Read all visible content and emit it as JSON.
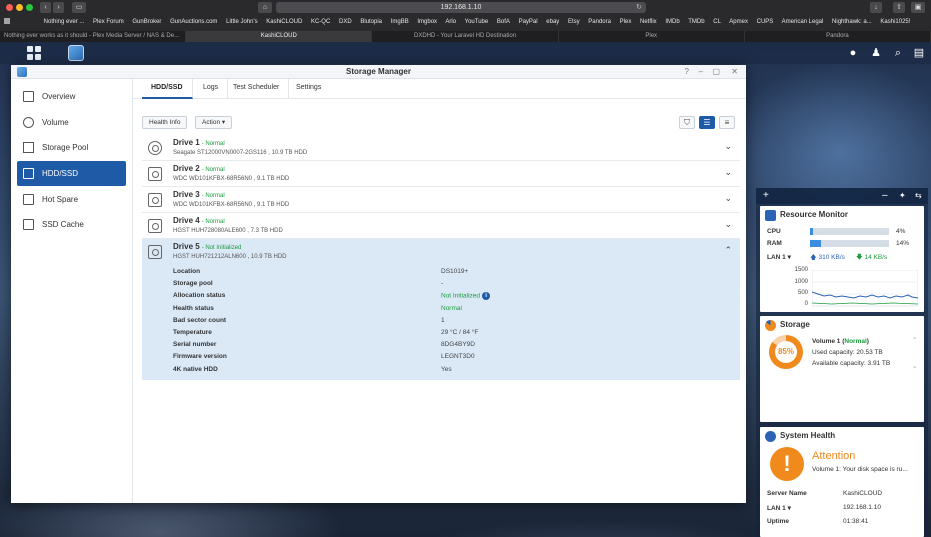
{
  "browser": {
    "url": "192.168.1.10",
    "favorites": [
      "Nothing ever ...",
      "Plex Forum",
      "GunBroker",
      "GunAuctions.com",
      "Little John's",
      "KashiCLOUD",
      "KC-QC",
      "DXD",
      "Blutopia",
      "ImgBB",
      "Imgbox",
      "Arlo",
      "YouTube",
      "BofA",
      "PayPal",
      "ebay",
      "Etsy",
      "Pandora",
      "Plex",
      "Netflix",
      "IMDb",
      "TMDb",
      "CL",
      "Apmex",
      "CUPS",
      "American Legal",
      "Nighthawk: a...",
      "Kashi1025!"
    ],
    "tabs": [
      "Nothing ever works as it should - Plex Media Server / NAS & De...",
      "KashiCLOUD",
      "DXDHD - Your Laravel HD Destination",
      "Plex",
      "Pandora"
    ],
    "active_tab": 1
  },
  "window": {
    "title": "Storage Manager",
    "controls": [
      "?",
      "–",
      "▢",
      "✕"
    ]
  },
  "sidebar": {
    "items": [
      {
        "label": "Overview",
        "icon": "overview-icon"
      },
      {
        "label": "Volume",
        "icon": "volume-icon"
      },
      {
        "label": "Storage Pool",
        "icon": "storage-pool-icon"
      },
      {
        "label": "HDD/SSD",
        "icon": "hdd-icon",
        "active": true
      },
      {
        "label": "Hot Spare",
        "icon": "hot-spare-icon"
      },
      {
        "label": "SSD Cache",
        "icon": "ssd-cache-icon"
      }
    ]
  },
  "tabs": [
    "HDD/SSD",
    "Logs",
    "Test Scheduler",
    "Settings"
  ],
  "toolbar": {
    "health_info": "Health Info",
    "action": "Action ▾"
  },
  "drives": [
    {
      "name": "Drive 1",
      "status": "- Normal",
      "model": "Seagate ST12000VN0007-2GS116 , 10.9 TB HDD"
    },
    {
      "name": "Drive 2",
      "status": "- Normal",
      "model": "WDC WD101KFBX-68R56N0 , 9.1 TB HDD"
    },
    {
      "name": "Drive 3",
      "status": "- Normal",
      "model": "WDC WD101KFBX-68R56N0 , 9.1 TB HDD"
    },
    {
      "name": "Drive 4",
      "status": "- Normal",
      "model": "HGST HUH728080ALE600 , 7.3 TB HDD"
    },
    {
      "name": "Drive 5",
      "status": "- Not Initialized",
      "model": "HGST HUH721212ALN600 , 10.9 TB HDD"
    }
  ],
  "drive5_details": [
    {
      "label": "Location",
      "value": "DS1019+"
    },
    {
      "label": "Storage pool",
      "value": "-"
    },
    {
      "label": "Allocation status",
      "value": "Not Initialized"
    },
    {
      "label": "Health status",
      "value": "Normal"
    },
    {
      "label": "Bad sector count",
      "value": "1"
    },
    {
      "label": "Temperature",
      "value": "29 °C / 84 °F"
    },
    {
      "label": "Serial number",
      "value": "8DG4BY9D"
    },
    {
      "label": "Firmware version",
      "value": "LEGNT3D0"
    },
    {
      "label": "4K native HDD",
      "value": "Yes"
    }
  ],
  "resource_monitor": {
    "title": "Resource Monitor",
    "cpu_label": "CPU",
    "cpu_pct": 4,
    "cpu_text": "4%",
    "ram_label": "RAM",
    "ram_pct": 14,
    "ram_text": "14%",
    "lan_label": "LAN 1 ▾",
    "up": "310 KB/s",
    "down": "14 KB/s",
    "y_ticks": [
      "1500",
      "1000",
      "500",
      "0"
    ]
  },
  "storage_widget": {
    "title": "Storage",
    "percent": 85,
    "percent_text": "85%",
    "volume_prefix": "Volume 1 (",
    "volume_status": "Normal",
    "volume_suffix": ")",
    "used": "Used capacity: 20.53 TB",
    "available": "Available capacity: 3.91 TB"
  },
  "system_health": {
    "title": "System Health",
    "state": "Attention",
    "message": "Volume 1: Your disk space is ru...",
    "rows": [
      {
        "label": "Server Name",
        "value": "KashiCLOUD"
      },
      {
        "label": "LAN 1 ▾",
        "value": "192.168.1.10"
      },
      {
        "label": "Uptime",
        "value": "01:38:41"
      }
    ]
  },
  "colors": {
    "accent": "#1f5aa6",
    "normal": "#1a9c3e",
    "warning": "#f08a1c"
  }
}
